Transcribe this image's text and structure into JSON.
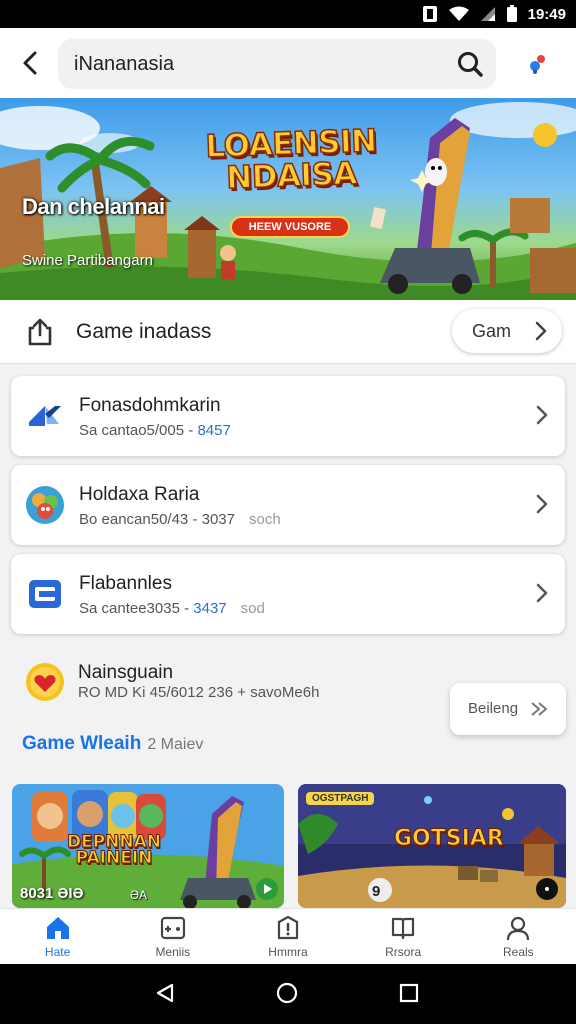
{
  "status_bar": {
    "time": "19:49"
  },
  "search": {
    "query": "iNananasia"
  },
  "banner": {
    "title": "LOAENSIN NDAISA",
    "badge": "HEEW VUSORE",
    "heading": "Dan chelannai",
    "subheading": "Swine Partibangarn"
  },
  "section": {
    "title": "Game inadass",
    "button_label": "Gam"
  },
  "list": [
    {
      "title": "Fonasdohmkarin",
      "meta": "Sa cantao5/005",
      "dash": "-",
      "accent": "8457",
      "extra": "",
      "icon": "k-logo-icon"
    },
    {
      "title": "Holdaxa Raria",
      "meta": "Bo eancan50/43",
      "dash": "-",
      "accent": "3037",
      "extra": "soch",
      "icon": "game-avatar-icon"
    },
    {
      "title": "Flabannles",
      "meta": "Sa cantee3035",
      "dash": "-",
      "accent": "3437",
      "extra": "sod",
      "icon": "store-icon"
    },
    {
      "title": "Nainsguain",
      "meta": "RO MD Ki 45/6012 236",
      "dash": "+",
      "accent": "",
      "extra": "savoMe6h",
      "icon": "emoji-heart-icon"
    }
  ],
  "floating_button": {
    "label": "Beileng"
  },
  "more": {
    "title": "Game Wleaih",
    "subtitle": "2 Maiev"
  },
  "thumbnails": [
    {
      "tag": "",
      "title": "DEPNNAN PAINEIN",
      "caption": "8031 ƏIƏ",
      "small": "ƏA"
    },
    {
      "tag": "OGSTPAGH",
      "title": "GOTSIAR",
      "caption": "9",
      "small": ""
    }
  ],
  "bottom_nav": [
    {
      "label": "Hate",
      "icon": "home-icon",
      "active": true
    },
    {
      "label": "Meniis",
      "icon": "gamepad-icon",
      "active": false
    },
    {
      "label": "Hmmra",
      "icon": "alert-icon",
      "active": false
    },
    {
      "label": "Rrsora",
      "icon": "book-icon",
      "active": false
    },
    {
      "label": "Reals",
      "icon": "profile-icon",
      "active": false
    }
  ],
  "colors": {
    "accent": "#1a73e8",
    "banner_title": "#ffcb2e"
  }
}
